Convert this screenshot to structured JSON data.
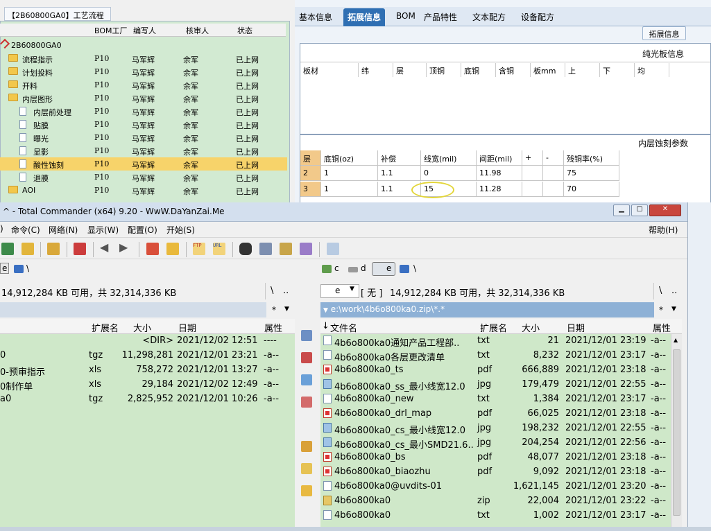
{
  "tree": {
    "title": "【2B60800GA0】工艺流程",
    "headers": [
      "BOM工厂",
      "编写人",
      "核审人",
      "状态"
    ],
    "root": "2B60800GA0",
    "rows": [
      {
        "name": "流程指示",
        "type": "folder",
        "bom": "P10",
        "writer": "马军辉",
        "reviewer": "余军",
        "status": "已上网"
      },
      {
        "name": "计划投料",
        "type": "folder",
        "bom": "P10",
        "writer": "马军辉",
        "reviewer": "余军",
        "status": "已上网"
      },
      {
        "name": "开料",
        "type": "folder",
        "bom": "P10",
        "writer": "马军辉",
        "reviewer": "余军",
        "status": "已上网"
      },
      {
        "name": "内层图形",
        "type": "folder",
        "bom": "P10",
        "writer": "马军辉",
        "reviewer": "余军",
        "status": "已上网"
      },
      {
        "name": "内层前处理",
        "type": "doc",
        "bom": "P10",
        "writer": "马军辉",
        "reviewer": "余军",
        "status": "已上网"
      },
      {
        "name": "贴膜",
        "type": "doc",
        "bom": "P10",
        "writer": "马军辉",
        "reviewer": "余军",
        "status": "已上网"
      },
      {
        "name": "曝光",
        "type": "doc",
        "bom": "P10",
        "writer": "马军辉",
        "reviewer": "余军",
        "status": "已上网"
      },
      {
        "name": "显影",
        "type": "doc",
        "bom": "P10",
        "writer": "马军辉",
        "reviewer": "余军",
        "status": "已上网"
      },
      {
        "name": "酸性蚀刻",
        "type": "doc",
        "bom": "P10",
        "writer": "马军辉",
        "reviewer": "余军",
        "status": "已上网",
        "selected": true
      },
      {
        "name": "退膜",
        "type": "doc",
        "bom": "P10",
        "writer": "马军辉",
        "reviewer": "余军",
        "status": "已上网"
      },
      {
        "name": "AOI",
        "type": "folder",
        "bom": "P10",
        "writer": "马军辉",
        "reviewer": "余军",
        "status": "已上网"
      }
    ]
  },
  "tabs": [
    "基本信息",
    "拓展信息",
    "BOM",
    "产品特性",
    "文本配方",
    "设备配方"
  ],
  "ext_button": "拓展信息",
  "bare_board": {
    "title": "纯光板信息",
    "headers": [
      "板材",
      "纬",
      "层",
      "顶铜",
      "底铜",
      "含铜",
      "板mm",
      "上",
      "下",
      "均"
    ]
  },
  "etch": {
    "title": "内层蚀刻参数",
    "headers": [
      "层",
      "底铜(oz)",
      "补偿",
      "线宽(mil)",
      "间距(mil)",
      "+",
      "-",
      "残铜率(%)"
    ],
    "rows": [
      [
        "2",
        "1",
        "1.1",
        "0",
        "11.98",
        "",
        "",
        "75"
      ],
      [
        "3",
        "1",
        "1.1",
        "15",
        "11.28",
        "",
        "",
        "70"
      ]
    ]
  },
  "tc": {
    "title": "^ - Total Commander (x64) 9.20 - WwW.DaYanZai.Me",
    "menu": [
      "命令(C)",
      "网络(N)",
      "显示(W)",
      "配置(O)",
      "开始(S)",
      "帮助(H)"
    ],
    "left": {
      "drive": "e",
      "root": "\\",
      "free": "14,912,284 KB 可用，共 32,314,336 KB",
      "nav": [
        "\\",
        ".."
      ],
      "filter": [
        "*",
        "▼"
      ],
      "headers": [
        "扩展名",
        "大小",
        "日期",
        "属性"
      ],
      "rows": [
        {
          "name": "",
          "ext": "",
          "size": "<DIR>",
          "date": "2021/12/02 12:51",
          "attr": "----"
        },
        {
          "name": "0",
          "ext": "tgz",
          "size": "11,298,281",
          "date": "2021/12/01 23:21",
          "attr": "-a--"
        },
        {
          "name": "0-预审指示",
          "ext": "xls",
          "size": "758,272",
          "date": "2021/12/01 13:27",
          "attr": "-a--"
        },
        {
          "name": "0制作单",
          "ext": "xls",
          "size": "29,184",
          "date": "2021/12/02 12:49",
          "attr": "-a--"
        },
        {
          "name": "a0",
          "ext": "tgz",
          "size": "2,825,952",
          "date": "2021/12/01 10:26",
          "attr": "-a--"
        }
      ]
    },
    "right": {
      "drives": [
        "c",
        "d",
        "e"
      ],
      "root": "\\",
      "drive_select": "e",
      "label": "[ 无 ]",
      "free": "14,912,284 KB 可用，共 32,314,336 KB",
      "nav": [
        "\\",
        ".."
      ],
      "path": "e:\\work\\4b6o800ka0.zip\\*.*",
      "filter": [
        "*",
        "▼"
      ],
      "headers": [
        "文件名",
        "扩展名",
        "大小",
        "日期",
        "属性"
      ],
      "sort_arrow": "↓",
      "rows": [
        {
          "name": "4b6o800ka0通知产品工程部..",
          "ext": "txt",
          "size": "21",
          "date": "2021/12/01 23:19",
          "attr": "-a--",
          "icon": "txt"
        },
        {
          "name": "4b6o800ka0各层更改清单",
          "ext": "txt",
          "size": "8,232",
          "date": "2021/12/01 23:17",
          "attr": "-a--",
          "icon": "txt"
        },
        {
          "name": "4b6o800ka0_ts",
          "ext": "pdf",
          "size": "666,889",
          "date": "2021/12/01 23:18",
          "attr": "-a--",
          "icon": "pdf"
        },
        {
          "name": "4b6o800ka0_ss_最小线宽12.0",
          "ext": "jpg",
          "size": "179,479",
          "date": "2021/12/01 22:55",
          "attr": "-a--",
          "icon": "jpg"
        },
        {
          "name": "4b6o800ka0_new",
          "ext": "txt",
          "size": "1,384",
          "date": "2021/12/01 23:17",
          "attr": "-a--",
          "icon": "txt"
        },
        {
          "name": "4b6o800ka0_drl_map",
          "ext": "pdf",
          "size": "66,025",
          "date": "2021/12/01 23:18",
          "attr": "-a--",
          "icon": "pdf"
        },
        {
          "name": "4b6o800ka0_cs_最小线宽12.0",
          "ext": "jpg",
          "size": "198,232",
          "date": "2021/12/01 22:55",
          "attr": "-a--",
          "icon": "jpg"
        },
        {
          "name": "4b6o800ka0_cs_最小SMD21.6..",
          "ext": "jpg",
          "size": "204,254",
          "date": "2021/12/01 22:56",
          "attr": "-a--",
          "icon": "jpg"
        },
        {
          "name": "4b6o800ka0_bs",
          "ext": "pdf",
          "size": "48,077",
          "date": "2021/12/01 23:18",
          "attr": "-a--",
          "icon": "pdf"
        },
        {
          "name": "4b6o800ka0_biaozhu",
          "ext": "pdf",
          "size": "9,092",
          "date": "2021/12/01 23:18",
          "attr": "-a--",
          "icon": "pdf"
        },
        {
          "name": "4b6o800ka0@uvdits-01",
          "ext": "",
          "size": "1,621,145",
          "date": "2021/12/01 23:20",
          "attr": "-a--",
          "icon": "txt"
        },
        {
          "name": "4b6o800ka0",
          "ext": "zip",
          "size": "22,004",
          "date": "2021/12/01 23:22",
          "attr": "-a--",
          "icon": "zip"
        },
        {
          "name": "4b6o800ka0",
          "ext": "txt",
          "size": "1,002",
          "date": "2021/12/01 23:17",
          "attr": "-a--",
          "icon": "txt"
        }
      ]
    }
  }
}
